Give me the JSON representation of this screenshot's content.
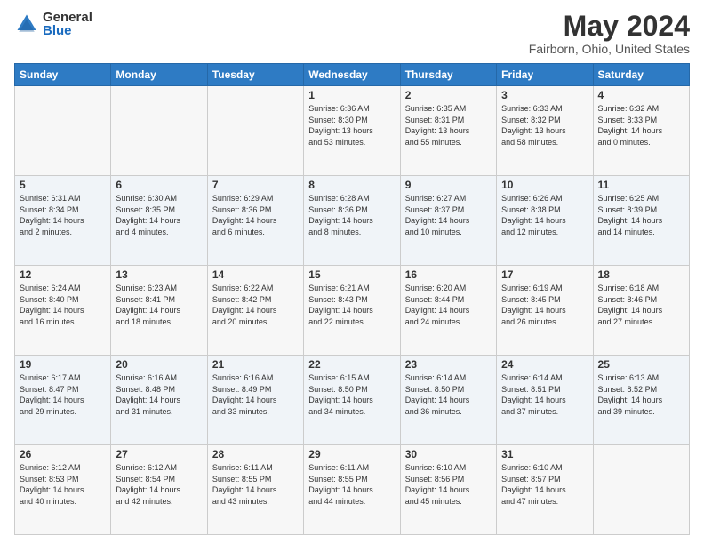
{
  "header": {
    "logo_general": "General",
    "logo_blue": "Blue",
    "title": "May 2024",
    "subtitle": "Fairborn, Ohio, United States"
  },
  "days_of_week": [
    "Sunday",
    "Monday",
    "Tuesday",
    "Wednesday",
    "Thursday",
    "Friday",
    "Saturday"
  ],
  "weeks": [
    {
      "shade": "even",
      "days": [
        {
          "num": "",
          "info": ""
        },
        {
          "num": "",
          "info": ""
        },
        {
          "num": "",
          "info": ""
        },
        {
          "num": "1",
          "info": "Sunrise: 6:36 AM\nSunset: 8:30 PM\nDaylight: 13 hours\nand 53 minutes."
        },
        {
          "num": "2",
          "info": "Sunrise: 6:35 AM\nSunset: 8:31 PM\nDaylight: 13 hours\nand 55 minutes."
        },
        {
          "num": "3",
          "info": "Sunrise: 6:33 AM\nSunset: 8:32 PM\nDaylight: 13 hours\nand 58 minutes."
        },
        {
          "num": "4",
          "info": "Sunrise: 6:32 AM\nSunset: 8:33 PM\nDaylight: 14 hours\nand 0 minutes."
        }
      ]
    },
    {
      "shade": "odd",
      "days": [
        {
          "num": "5",
          "info": "Sunrise: 6:31 AM\nSunset: 8:34 PM\nDaylight: 14 hours\nand 2 minutes."
        },
        {
          "num": "6",
          "info": "Sunrise: 6:30 AM\nSunset: 8:35 PM\nDaylight: 14 hours\nand 4 minutes."
        },
        {
          "num": "7",
          "info": "Sunrise: 6:29 AM\nSunset: 8:36 PM\nDaylight: 14 hours\nand 6 minutes."
        },
        {
          "num": "8",
          "info": "Sunrise: 6:28 AM\nSunset: 8:36 PM\nDaylight: 14 hours\nand 8 minutes."
        },
        {
          "num": "9",
          "info": "Sunrise: 6:27 AM\nSunset: 8:37 PM\nDaylight: 14 hours\nand 10 minutes."
        },
        {
          "num": "10",
          "info": "Sunrise: 6:26 AM\nSunset: 8:38 PM\nDaylight: 14 hours\nand 12 minutes."
        },
        {
          "num": "11",
          "info": "Sunrise: 6:25 AM\nSunset: 8:39 PM\nDaylight: 14 hours\nand 14 minutes."
        }
      ]
    },
    {
      "shade": "even",
      "days": [
        {
          "num": "12",
          "info": "Sunrise: 6:24 AM\nSunset: 8:40 PM\nDaylight: 14 hours\nand 16 minutes."
        },
        {
          "num": "13",
          "info": "Sunrise: 6:23 AM\nSunset: 8:41 PM\nDaylight: 14 hours\nand 18 minutes."
        },
        {
          "num": "14",
          "info": "Sunrise: 6:22 AM\nSunset: 8:42 PM\nDaylight: 14 hours\nand 20 minutes."
        },
        {
          "num": "15",
          "info": "Sunrise: 6:21 AM\nSunset: 8:43 PM\nDaylight: 14 hours\nand 22 minutes."
        },
        {
          "num": "16",
          "info": "Sunrise: 6:20 AM\nSunset: 8:44 PM\nDaylight: 14 hours\nand 24 minutes."
        },
        {
          "num": "17",
          "info": "Sunrise: 6:19 AM\nSunset: 8:45 PM\nDaylight: 14 hours\nand 26 minutes."
        },
        {
          "num": "18",
          "info": "Sunrise: 6:18 AM\nSunset: 8:46 PM\nDaylight: 14 hours\nand 27 minutes."
        }
      ]
    },
    {
      "shade": "odd",
      "days": [
        {
          "num": "19",
          "info": "Sunrise: 6:17 AM\nSunset: 8:47 PM\nDaylight: 14 hours\nand 29 minutes."
        },
        {
          "num": "20",
          "info": "Sunrise: 6:16 AM\nSunset: 8:48 PM\nDaylight: 14 hours\nand 31 minutes."
        },
        {
          "num": "21",
          "info": "Sunrise: 6:16 AM\nSunset: 8:49 PM\nDaylight: 14 hours\nand 33 minutes."
        },
        {
          "num": "22",
          "info": "Sunrise: 6:15 AM\nSunset: 8:50 PM\nDaylight: 14 hours\nand 34 minutes."
        },
        {
          "num": "23",
          "info": "Sunrise: 6:14 AM\nSunset: 8:50 PM\nDaylight: 14 hours\nand 36 minutes."
        },
        {
          "num": "24",
          "info": "Sunrise: 6:14 AM\nSunset: 8:51 PM\nDaylight: 14 hours\nand 37 minutes."
        },
        {
          "num": "25",
          "info": "Sunrise: 6:13 AM\nSunset: 8:52 PM\nDaylight: 14 hours\nand 39 minutes."
        }
      ]
    },
    {
      "shade": "even",
      "days": [
        {
          "num": "26",
          "info": "Sunrise: 6:12 AM\nSunset: 8:53 PM\nDaylight: 14 hours\nand 40 minutes."
        },
        {
          "num": "27",
          "info": "Sunrise: 6:12 AM\nSunset: 8:54 PM\nDaylight: 14 hours\nand 42 minutes."
        },
        {
          "num": "28",
          "info": "Sunrise: 6:11 AM\nSunset: 8:55 PM\nDaylight: 14 hours\nand 43 minutes."
        },
        {
          "num": "29",
          "info": "Sunrise: 6:11 AM\nSunset: 8:55 PM\nDaylight: 14 hours\nand 44 minutes."
        },
        {
          "num": "30",
          "info": "Sunrise: 6:10 AM\nSunset: 8:56 PM\nDaylight: 14 hours\nand 45 minutes."
        },
        {
          "num": "31",
          "info": "Sunrise: 6:10 AM\nSunset: 8:57 PM\nDaylight: 14 hours\nand 47 minutes."
        },
        {
          "num": "",
          "info": ""
        }
      ]
    }
  ]
}
